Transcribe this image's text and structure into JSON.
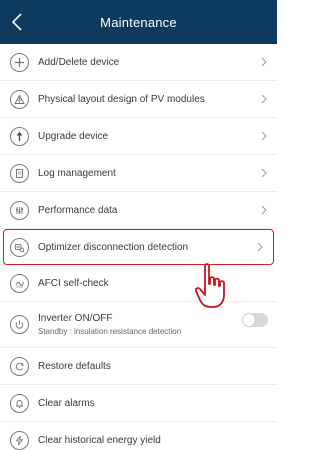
{
  "header": {
    "title": "Maintenance",
    "background": "#0e3a5e"
  },
  "menu": [
    {
      "key": "add",
      "label": "Add/Delete device",
      "icon": "plus-circle-icon",
      "chevron": true
    },
    {
      "key": "layout",
      "label": "Physical layout design of PV modules",
      "icon": "pv-layout-icon",
      "chevron": true
    },
    {
      "key": "upgrade",
      "label": "Upgrade device",
      "icon": "upload-arrow-icon",
      "chevron": true
    },
    {
      "key": "log",
      "label": "Log management",
      "icon": "document-icon",
      "chevron": true
    },
    {
      "key": "perf",
      "label": "Performance data",
      "icon": "performance-icon",
      "chevron": true
    },
    {
      "key": "optimizer",
      "label": "Optimizer disconnection detection",
      "icon": "optimizer-icon",
      "chevron": true,
      "highlighted": true
    },
    {
      "key": "afci",
      "label": "AFCI self-check",
      "icon": "afci-icon",
      "chevron": false
    },
    {
      "key": "inverter",
      "label": "Inverter ON/OFF",
      "sub": "Standby : insulation resistance detection",
      "icon": "power-icon",
      "toggle": false
    },
    {
      "key": "restore",
      "label": "Restore defaults",
      "icon": "restore-icon",
      "chevron": false
    },
    {
      "key": "alarms",
      "label": "Clear alarms",
      "icon": "alarm-bell-icon",
      "chevron": false
    },
    {
      "key": "energy",
      "label": "Clear historical energy yield",
      "icon": "energy-bolt-icon",
      "chevron": false
    }
  ],
  "highlight_color": "#d81b25"
}
